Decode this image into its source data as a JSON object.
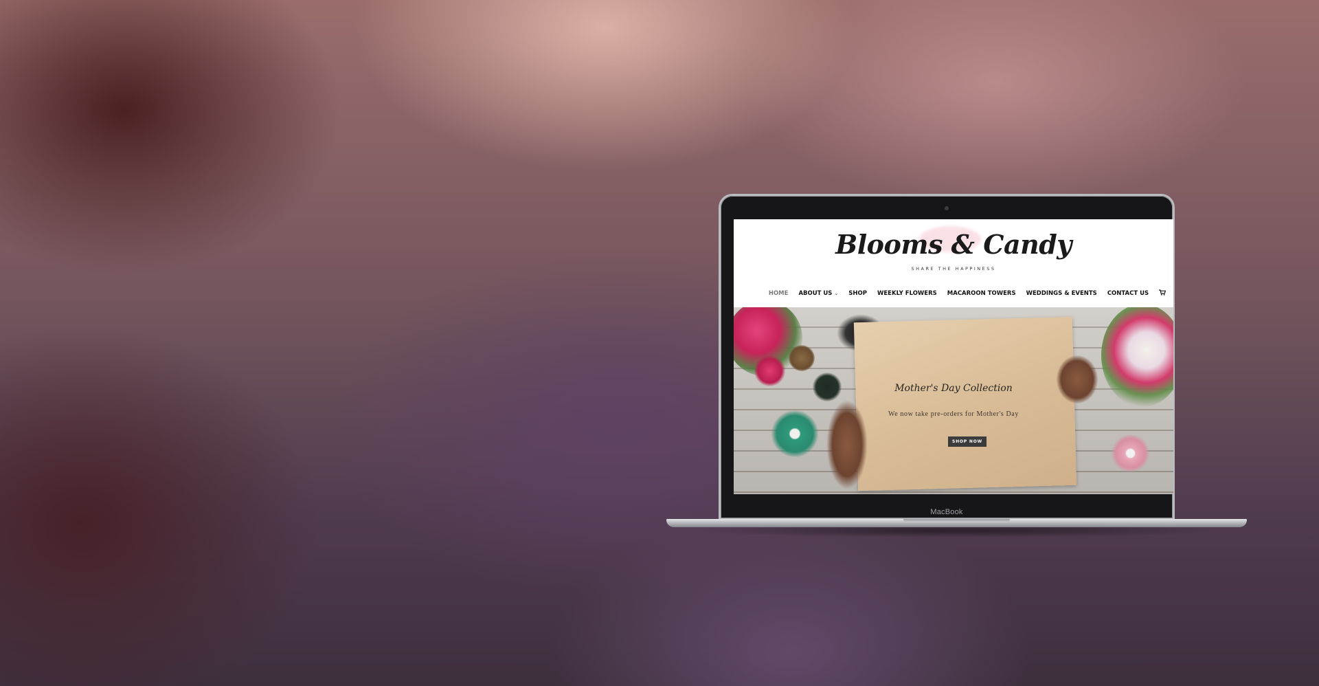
{
  "device": {
    "label": "MacBook"
  },
  "site": {
    "logo": "Blooms & Candy",
    "tagline": "SHARE THE HAPPINESS",
    "nav": {
      "items": [
        {
          "label": "HOME"
        },
        {
          "label": "ABOUT US"
        },
        {
          "label": "SHOP"
        },
        {
          "label": "WEEKLY FLOWERS"
        },
        {
          "label": "MACAROON TOWERS"
        },
        {
          "label": "WEDDINGS & EVENTS"
        },
        {
          "label": "CONTACT US"
        }
      ],
      "active_index": 0,
      "cart_icon": "cart-icon"
    },
    "hero": {
      "title": "Mother's Day Collection",
      "subtitle": "We now take pre-orders for Mother's Day",
      "button_label": "SHOP NOW"
    }
  },
  "colors": {
    "accent_pink": "#d6336c",
    "button_bg": "#3b3b3b",
    "paper": "#dcc29e"
  }
}
